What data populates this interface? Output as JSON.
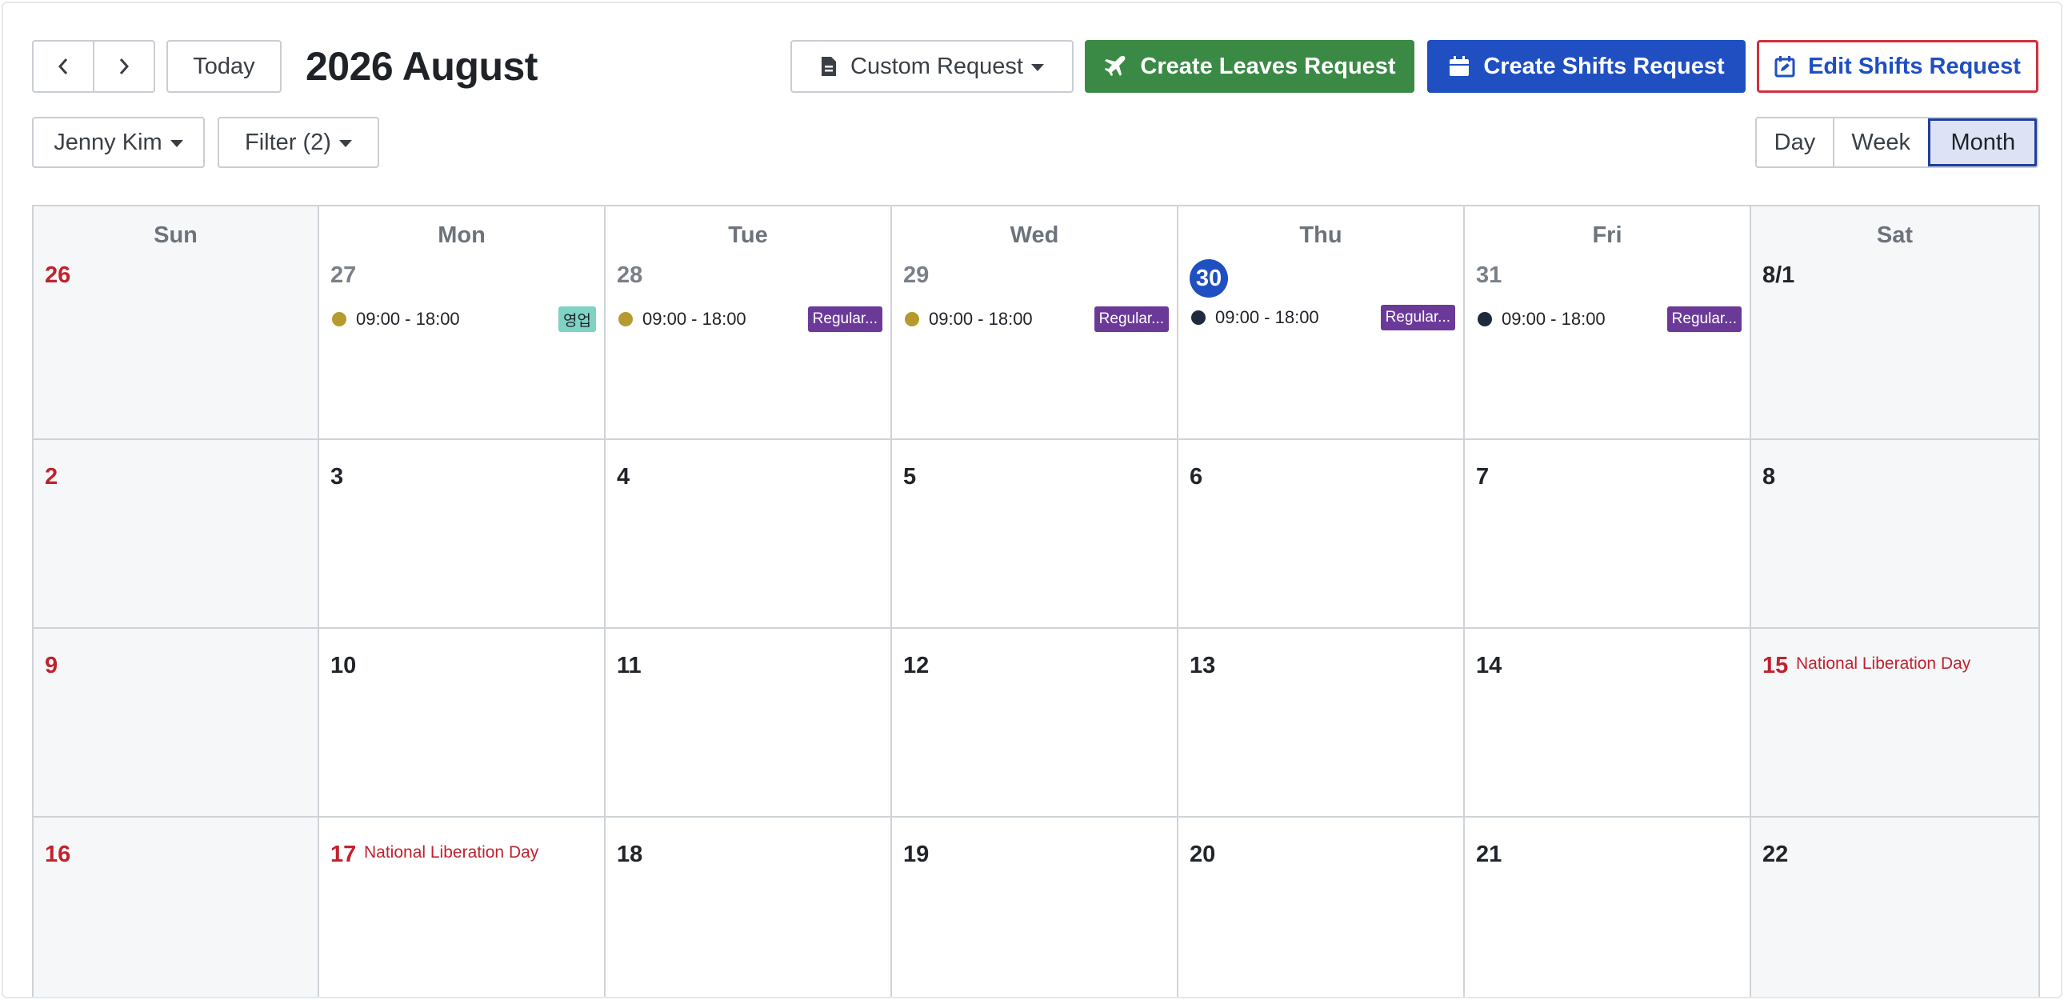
{
  "toolbar": {
    "today_label": "Today",
    "title": "2026 August",
    "custom_request_label": "Custom Request",
    "create_leaves_label": "Create Leaves Request",
    "create_shifts_label": "Create Shifts Request",
    "edit_shifts_label": "Edit Shifts Request",
    "user_label": "Jenny Kim",
    "filter_label": "Filter (2)",
    "views": [
      "Day",
      "Week",
      "Month"
    ],
    "active_view": "Month"
  },
  "colors": {
    "green": "#3a8a45",
    "blue": "#1f4fc1",
    "red": "#d1303c",
    "purple": "#6b3a99",
    "teal": "#7fd3c4",
    "gold": "#b79a2e",
    "navy": "#1f2a3c"
  },
  "calendar": {
    "weekdays": [
      "Sun",
      "Mon",
      "Tue",
      "Wed",
      "Thu",
      "Fri",
      "Sat"
    ],
    "weeks": [
      [
        {
          "day": "26",
          "style": "red"
        },
        {
          "day": "27",
          "style": "muted",
          "event": {
            "time": "09:00 - 18:00",
            "dot": "gold",
            "tag": "영업",
            "tag_style": "teal"
          }
        },
        {
          "day": "28",
          "style": "muted",
          "event": {
            "time": "09:00 - 18:00",
            "dot": "gold",
            "tag": "Regular...",
            "tag_style": "purple"
          }
        },
        {
          "day": "29",
          "style": "muted",
          "event": {
            "time": "09:00 - 18:00",
            "dot": "gold",
            "tag": "Regular...",
            "tag_style": "purple"
          }
        },
        {
          "day": "30",
          "style": "today",
          "event": {
            "time": "09:00 - 18:00",
            "dot": "navy",
            "tag": "Regular...",
            "tag_style": "purple"
          }
        },
        {
          "day": "31",
          "style": "muted",
          "event": {
            "time": "09:00 - 18:00",
            "dot": "navy",
            "tag": "Regular...",
            "tag_style": "purple"
          }
        },
        {
          "day": "8/1",
          "style": "normal"
        }
      ],
      [
        {
          "day": "2",
          "style": "red"
        },
        {
          "day": "3",
          "style": "normal"
        },
        {
          "day": "4",
          "style": "normal"
        },
        {
          "day": "5",
          "style": "normal"
        },
        {
          "day": "6",
          "style": "normal"
        },
        {
          "day": "7",
          "style": "normal"
        },
        {
          "day": "8",
          "style": "normal"
        }
      ],
      [
        {
          "day": "9",
          "style": "red"
        },
        {
          "day": "10",
          "style": "normal"
        },
        {
          "day": "11",
          "style": "normal"
        },
        {
          "day": "12",
          "style": "normal"
        },
        {
          "day": "13",
          "style": "normal"
        },
        {
          "day": "14",
          "style": "normal"
        },
        {
          "day": "15",
          "style": "red",
          "holiday": "National Liberation Day"
        }
      ],
      [
        {
          "day": "16",
          "style": "red"
        },
        {
          "day": "17",
          "style": "red",
          "holiday": "National Liberation Day"
        },
        {
          "day": "18",
          "style": "normal"
        },
        {
          "day": "19",
          "style": "normal"
        },
        {
          "day": "20",
          "style": "normal"
        },
        {
          "day": "21",
          "style": "normal"
        },
        {
          "day": "22",
          "style": "normal"
        }
      ]
    ]
  }
}
